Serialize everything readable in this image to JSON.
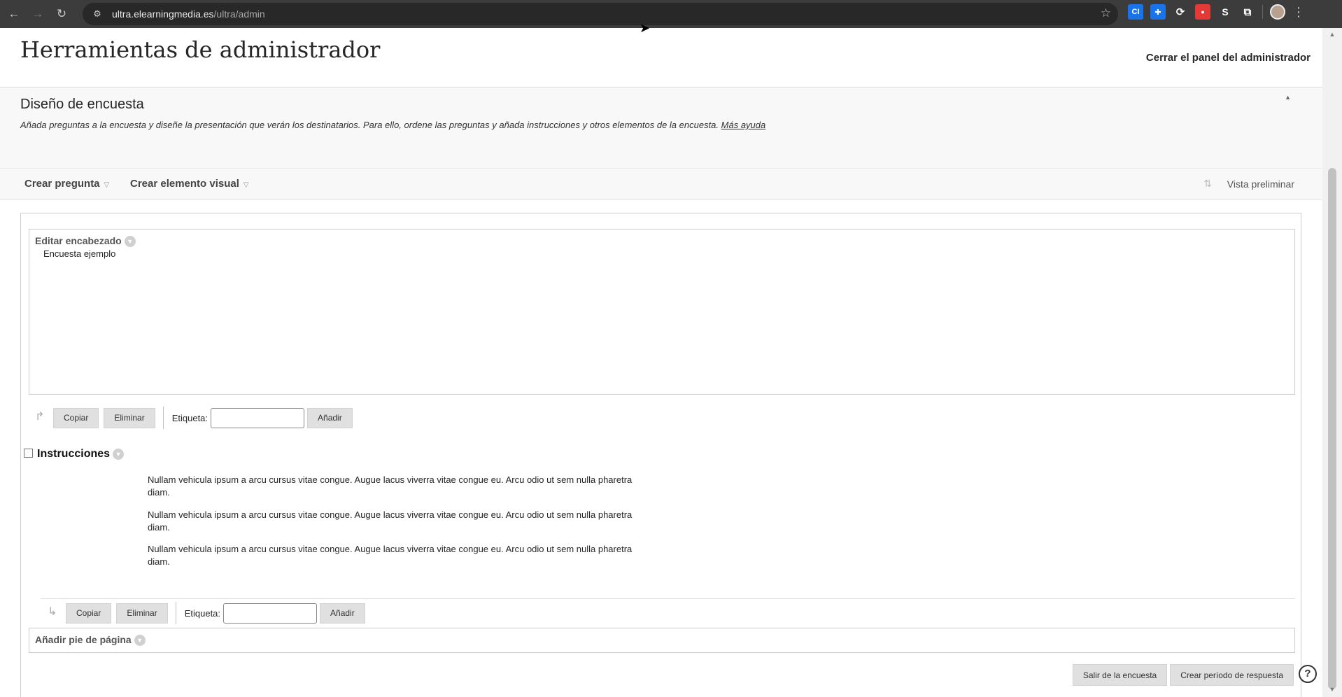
{
  "browser": {
    "url_host": "ultra.elearningmedia.es",
    "url_path": "/ultra/admin",
    "extensions": [
      {
        "name": "ci-extension-icon",
        "label": "CI",
        "color": "#1a73e8"
      },
      {
        "name": "plus-extension-icon",
        "label": "✚",
        "color": "#1a73e8"
      },
      {
        "name": "link-extension-icon",
        "label": "⟳",
        "color": "#3c3c3c"
      },
      {
        "name": "red-extension-icon",
        "label": "●",
        "color": "#e53935"
      },
      {
        "name": "s-extension-icon",
        "label": "S",
        "color": "#3c3c3c"
      },
      {
        "name": "puzzle-extension-icon",
        "label": "⧉",
        "color": "#3c3c3c"
      }
    ]
  },
  "admin": {
    "title": "Herramientas de administrador",
    "close_panel": "Cerrar el panel del administrador"
  },
  "section": {
    "title": "Diseño de encuesta",
    "description": "Añada preguntas a la encuesta y diseñe la presentación que verán los destinatarios. Para ello, ordene las preguntas y añada instrucciones y otros elementos de la encuesta.",
    "help_link": "Más ayuda"
  },
  "toolbar": {
    "create_question": "Crear pregunta",
    "create_visual": "Crear elemento visual",
    "preview": "Vista preliminar"
  },
  "header_box": {
    "title": "Editar encabezado",
    "text": "Encuesta ejemplo"
  },
  "actions": {
    "copy": "Copiar",
    "delete": "Eliminar",
    "label": "Etiqueta:",
    "add": "Añadir"
  },
  "instructions": {
    "title": "Instrucciones",
    "paragraphs": [
      "Nullam vehicula ipsum a arcu cursus vitae congue. Augue lacus viverra vitae congue eu. Arcu odio ut sem nulla pharetra diam.",
      "Nullam vehicula ipsum a arcu cursus vitae congue. Augue lacus viverra vitae congue eu. Arcu odio ut sem nulla pharetra diam.",
      "Nullam vehicula ipsum a arcu cursus vitae congue. Augue lacus viverra vitae congue eu. Arcu odio ut sem nulla pharetra diam."
    ]
  },
  "footer_box": {
    "title": "Añadir pie de página"
  },
  "bottom_buttons": {
    "exit": "Salir de la encuesta",
    "create_period": "Crear período de respuesta"
  }
}
